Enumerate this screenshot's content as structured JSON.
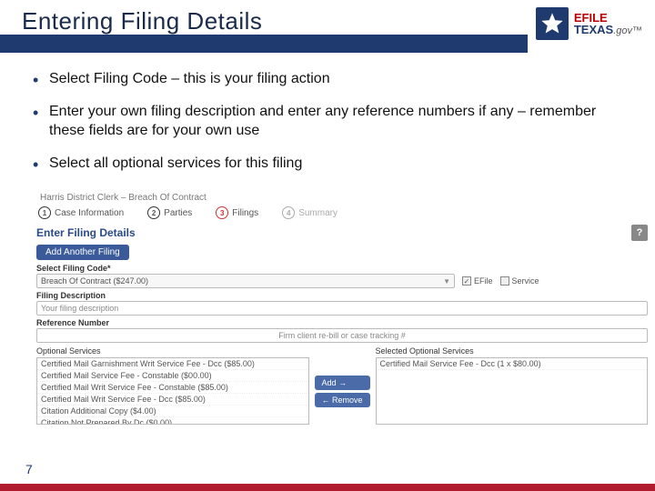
{
  "header": {
    "title": "Entering Filing Details"
  },
  "logo": {
    "efile": "EFILE",
    "texas": "TEXAS",
    "gov": ".gov"
  },
  "bullets": [
    "Select Filing Code – this is your filing action",
    "Enter your own filing description and enter any reference numbers if any – remember these fields are for your own use",
    "Select all optional services for this filing"
  ],
  "shot": {
    "breadcrumb": "Harris District Clerk   –   Breach Of Contract",
    "steps": [
      {
        "num": "1",
        "label": "Case Information"
      },
      {
        "num": "2",
        "label": "Parties"
      },
      {
        "num": "3",
        "label": "Filings"
      },
      {
        "num": "4",
        "label": "Summary"
      }
    ],
    "section_title": "Enter Filing Details",
    "add_filing_btn": "Add Another Filing",
    "help_icon": "?",
    "filing_code_label": "Select Filing Code*",
    "filing_code_value": "Breach Of Contract ($247.00)",
    "efile_label": "EFile",
    "service_label": "Service",
    "desc_label": "Filing Description",
    "desc_value": "Your filing description",
    "ref_label": "Reference Number",
    "ref_value": "Firm client re-bill or case tracking #",
    "opt_label": "Optional Services",
    "sel_label": "Selected Optional Services",
    "add_btn": "Add →",
    "remove_btn": "← Remove",
    "optional_services": [
      "Certified Mail Garnishment Writ Service Fee - Dcc ($85.00)",
      "Certified Mail Service Fee - Constable ($00.00)",
      "Certified Mail Writ Service Fee - Constable ($85.00)",
      "Certified Mail Writ Service Fee - Dcc ($85.00)",
      "Citation Additional Copy ($4.00)",
      "Citation Not Prepared By Dc ($0.00)"
    ],
    "selected_services": [
      "Certified Mail Service Fee - Dcc (1 x $80.00)"
    ]
  },
  "page_number": "7"
}
